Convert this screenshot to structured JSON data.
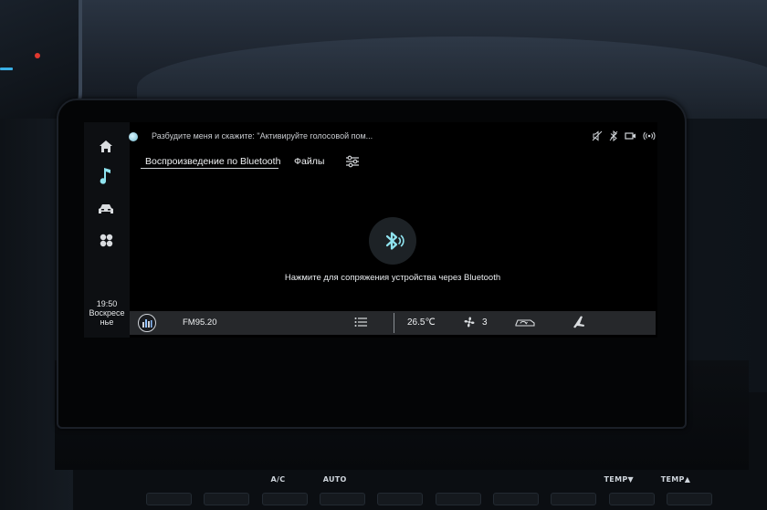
{
  "voice_hint": "Разбудите меня и скажите: \"Активируйте голосовой пом...",
  "status_icons": [
    "mute-icon",
    "bluetooth-off-icon",
    "camera-icon",
    "hotspot-icon"
  ],
  "sidebar": {
    "items": [
      {
        "name": "home",
        "icon": "home-icon",
        "active": false
      },
      {
        "name": "music",
        "icon": "music-note-icon",
        "active": true
      },
      {
        "name": "car",
        "icon": "car-icon",
        "active": false
      },
      {
        "name": "apps",
        "icon": "apps-grid-icon",
        "active": false
      }
    ],
    "clock": {
      "time": "19:50",
      "day_line1": "Воскресе",
      "day_line2": "нье"
    }
  },
  "tabs": [
    {
      "label": "Воспроизведение по Bluetooth",
      "active": true
    },
    {
      "label": "Файлы",
      "active": false
    }
  ],
  "bluetooth": {
    "icon": "bluetooth-icon",
    "prompt": "Нажмите для сопряжения устройства через Bluetooth"
  },
  "bottom_bar": {
    "radio_station": "FM95.20",
    "temperature": "26.5℃",
    "fan_speed": "3"
  },
  "hvac_buttons": [
    "",
    "",
    "A/C",
    "AUTO",
    "",
    "",
    "",
    "",
    "TEMP▼",
    "TEMP▲"
  ],
  "colors": {
    "accent": "#7ed6e6",
    "bar_bg": "#26282b",
    "screen_bg": "#000000"
  }
}
